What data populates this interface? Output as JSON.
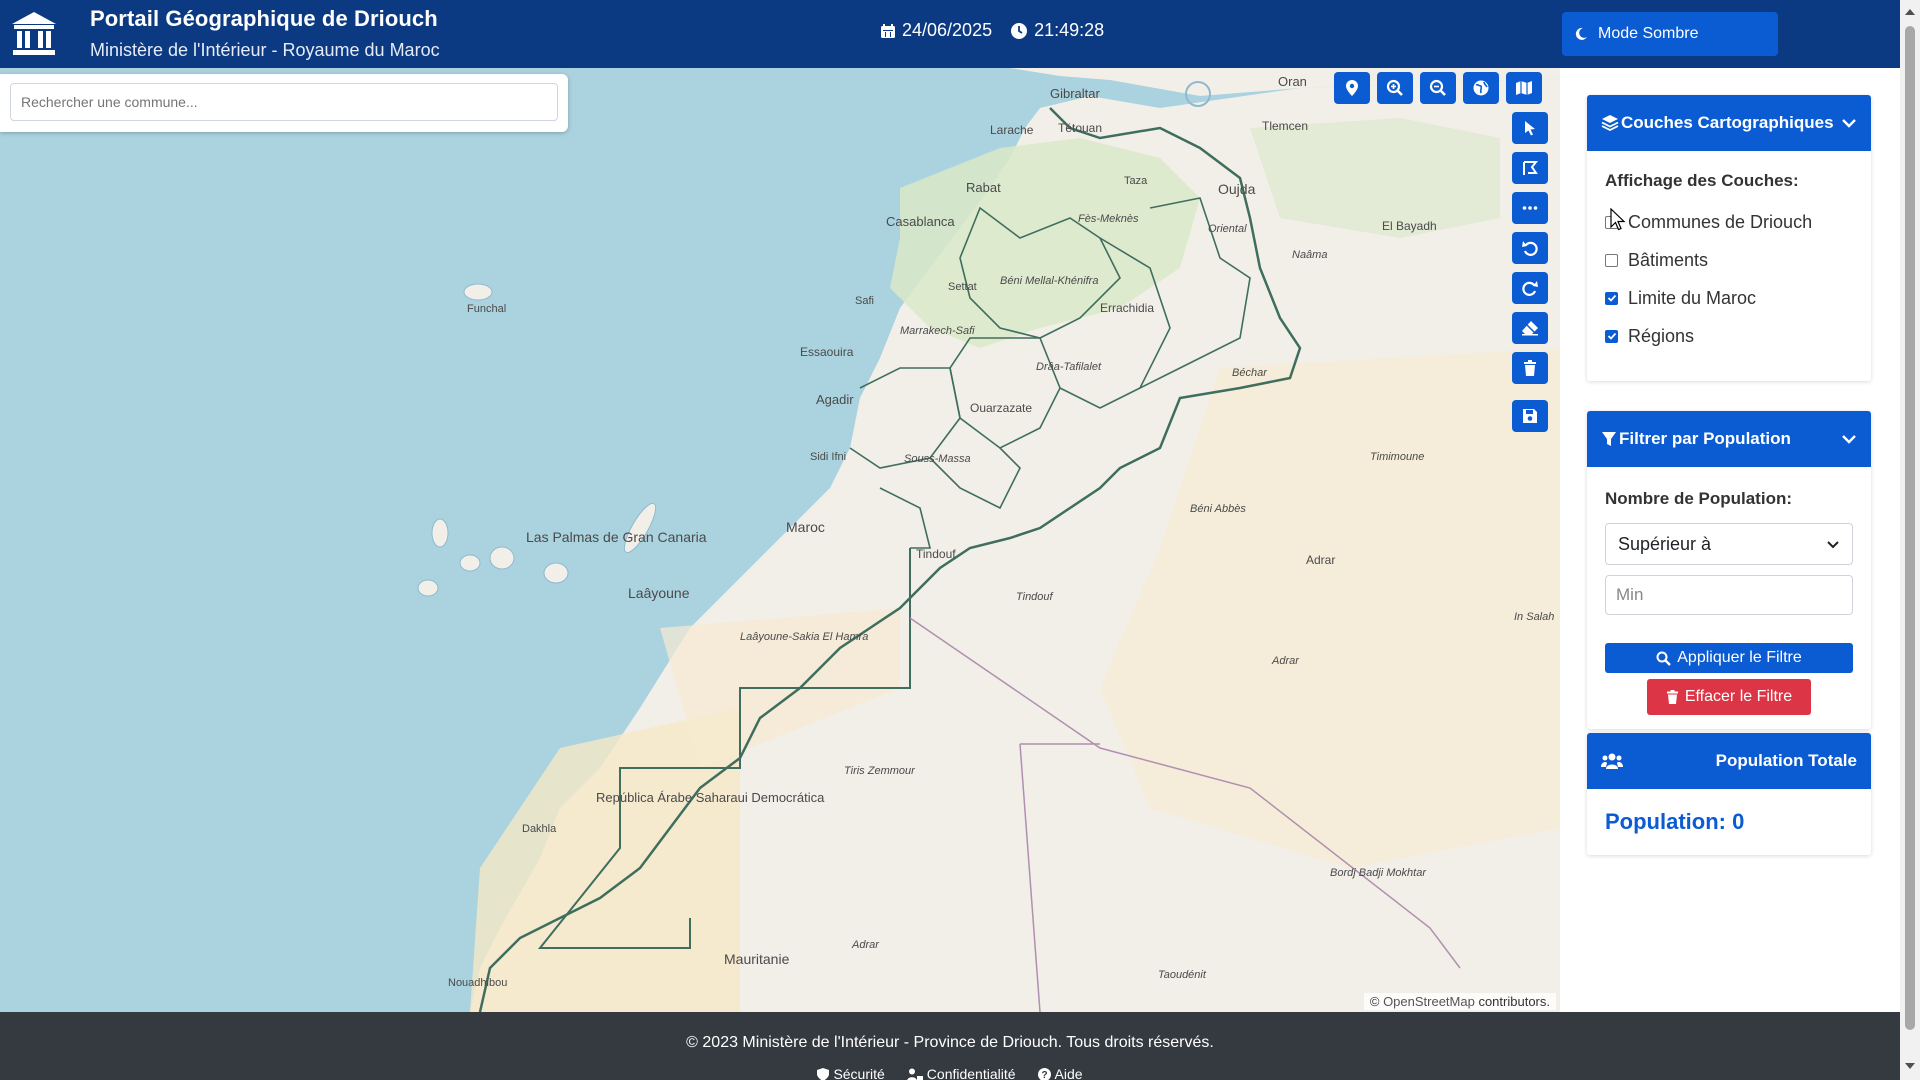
{
  "header": {
    "title": "Portail Géographique de Driouch",
    "subtitle": "Ministère de l'Intérieur - Royaume du Maroc",
    "date": "24/06/2025",
    "time": "21:49:28",
    "dark_mode_label": "Mode Sombre"
  },
  "search": {
    "placeholder": "Rechercher une commune..."
  },
  "map": {
    "labels": {
      "gibraltar": "Gibraltar",
      "oran": "Oran",
      "tlemcen": "Tlemcen",
      "larache": "Larache",
      "tetouan": "Tétouan",
      "rabat": "Rabat",
      "taza": "Taza",
      "oujda": "Oujda",
      "fes": "Fès-Meknès",
      "casablanca": "Casablanca",
      "oriental": "Oriental",
      "naama": "Naâma",
      "elbayadh": "El Bayadh",
      "funchal": "Funchal",
      "settat": "Settat",
      "beni": "Béni Mellal-Khénifra",
      "safi": "Safi",
      "errachidia": "Errachidia",
      "marrakech": "Marrakech-Safi",
      "essaouira": "Essaouira",
      "draa": "Drâa-Tafilalet",
      "bechar": "Béchar",
      "agadir": "Agadir",
      "ouarzazate": "Ouarzazate",
      "souss": "Souss-Massa",
      "sidiifni": "Sidi Ifni",
      "timimoune": "Timimoune",
      "lapalmas": "Las Palmas de Gran Canaria",
      "maroc": "Maroc",
      "beniabbes": "Béni Abbès",
      "tindouf": "Tindouf",
      "adrar": "Adrar",
      "laayoune": "Laâyoune",
      "laayoune_region": "Laâyoune-Sakia El Hamra",
      "insalah": "In Salah",
      "tiris": "Tiris Zemmour",
      "rasd": "República Árabe Saharaui Democrática",
      "dakhla": "Dakhla",
      "bordj": "Bordj Badji Mokhtar",
      "adrar_m": "Adrar",
      "mauritanie": "Mauritanie",
      "taoudenit": "Taoudénit",
      "nouadhibou": "Nouadhibou"
    },
    "attribution_prefix": "© ",
    "attribution_link": "OpenStreetMap",
    "attribution_suffix": " contributors."
  },
  "toolbar": {
    "top": [
      "locate-icon",
      "zoom-in-icon",
      "zoom-out-icon",
      "globe-icon",
      "map-icon"
    ],
    "side": [
      "pointer-icon",
      "draw-polygon-icon",
      "more-icon",
      "undo-icon",
      "redo-icon",
      "eraser-icon",
      "trash-icon",
      "save-icon"
    ]
  },
  "layers_panel": {
    "title": "Couches Cartographiques",
    "section_label": "Affichage des Couches:",
    "layers": [
      {
        "label": "Communes de Driouch",
        "checked": false
      },
      {
        "label": "Bâtiments",
        "checked": false
      },
      {
        "label": "Limite du Maroc",
        "checked": true
      },
      {
        "label": "Régions",
        "checked": true
      }
    ]
  },
  "filter_panel": {
    "title": "Filtrer par Population",
    "section_label": "Nombre de Population:",
    "select_value": "Supérieur à",
    "min_placeholder": "Min",
    "apply_label": "Appliquer le Filtre",
    "clear_label": "Effacer le Filtre"
  },
  "population_panel": {
    "title": "Population Totale",
    "value_text": "Population: 0"
  },
  "footer": {
    "copyright": "© 2023 Ministère de l'Intérieur - Province de Driouch. Tous droits réservés.",
    "links": [
      "Sécurité",
      "Confidentialité",
      "Aide"
    ]
  },
  "colors": {
    "header_bg": "#0b3a82",
    "accent": "#0b5bd3",
    "danger": "#dc3545",
    "footer_bg": "#343a40",
    "sea": "#aad3df"
  }
}
